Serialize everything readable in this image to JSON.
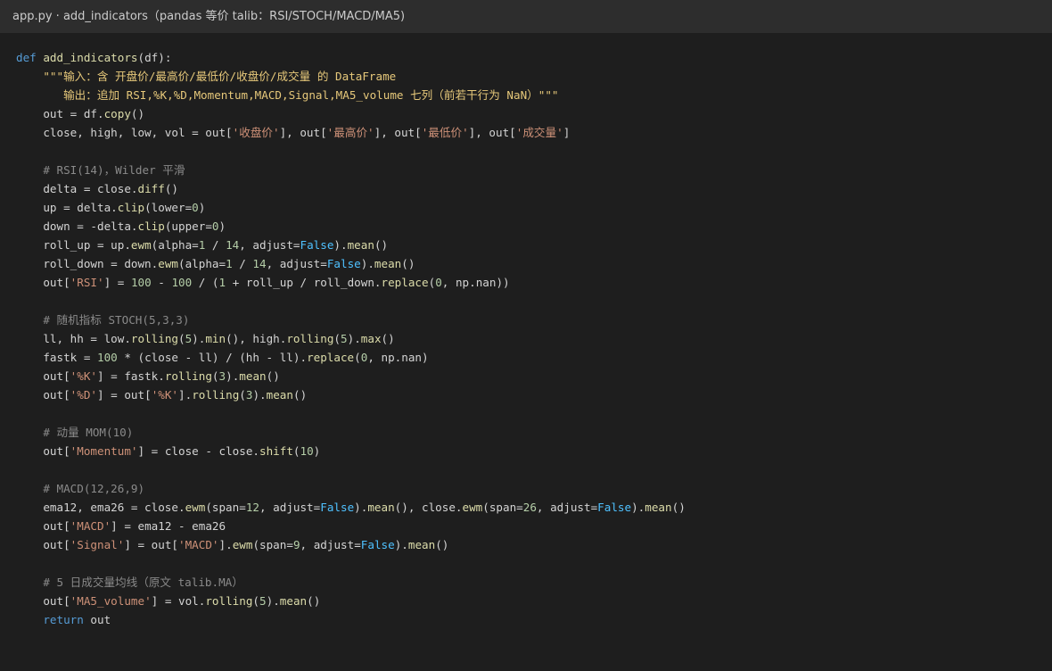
{
  "window": {
    "title": "app.py · add_indicators（pandas 等价 talib：RSI/STOCH/MACD/MA5)"
  },
  "colors": {
    "background": "#1e1e1e",
    "titlebar": "#2d2d2d",
    "keyword": "#569cd6",
    "function": "#dcdcaa",
    "string": "#ce9178",
    "number": "#b5cea8",
    "comment": "#8a8a8a",
    "boolean": "#4fc1ff"
  },
  "code": {
    "lines": [
      [
        {
          "t": "def ",
          "c": "kw"
        },
        {
          "t": "add_indicators",
          "c": "fn"
        },
        {
          "t": "(df):"
        }
      ],
      [
        {
          "t": "    \"\"\"输入：含 开盘价/最高价/最低价/收盘价/成交量 的 DataFrame",
          "c": "doc"
        }
      ],
      [
        {
          "t": "       输出：追加 RSI,%K,%D,Momentum,MACD,Signal,MA5_volume 七列（前若干行为 NaN）\"\"\"",
          "c": "doc"
        }
      ],
      [
        {
          "t": "    out = df."
        },
        {
          "t": "copy",
          "c": "fn"
        },
        {
          "t": "()"
        }
      ],
      [
        {
          "t": "    close, high, low, vol = out["
        },
        {
          "t": "'收盘价'",
          "c": "str"
        },
        {
          "t": "], out["
        },
        {
          "t": "'最高价'",
          "c": "str"
        },
        {
          "t": "], out["
        },
        {
          "t": "'最低价'",
          "c": "str"
        },
        {
          "t": "], out["
        },
        {
          "t": "'成交量'",
          "c": "str"
        },
        {
          "t": "]"
        }
      ],
      [],
      [
        {
          "t": "    # RSI(14)，Wilder 平滑",
          "c": "cmt"
        }
      ],
      [
        {
          "t": "    delta = close."
        },
        {
          "t": "diff",
          "c": "fn"
        },
        {
          "t": "()"
        }
      ],
      [
        {
          "t": "    up = delta."
        },
        {
          "t": "clip",
          "c": "fn"
        },
        {
          "t": "(lower="
        },
        {
          "t": "0",
          "c": "num"
        },
        {
          "t": ")"
        }
      ],
      [
        {
          "t": "    down = -delta."
        },
        {
          "t": "clip",
          "c": "fn"
        },
        {
          "t": "(upper="
        },
        {
          "t": "0",
          "c": "num"
        },
        {
          "t": ")"
        }
      ],
      [
        {
          "t": "    roll_up = up."
        },
        {
          "t": "ewm",
          "c": "fn"
        },
        {
          "t": "(alpha="
        },
        {
          "t": "1",
          "c": "num"
        },
        {
          "t": " / "
        },
        {
          "t": "14",
          "c": "num"
        },
        {
          "t": ", adjust="
        },
        {
          "t": "False",
          "c": "bool"
        },
        {
          "t": ")."
        },
        {
          "t": "mean",
          "c": "fn"
        },
        {
          "t": "()"
        }
      ],
      [
        {
          "t": "    roll_down = down."
        },
        {
          "t": "ewm",
          "c": "fn"
        },
        {
          "t": "(alpha="
        },
        {
          "t": "1",
          "c": "num"
        },
        {
          "t": " / "
        },
        {
          "t": "14",
          "c": "num"
        },
        {
          "t": ", adjust="
        },
        {
          "t": "False",
          "c": "bool"
        },
        {
          "t": ")."
        },
        {
          "t": "mean",
          "c": "fn"
        },
        {
          "t": "()"
        }
      ],
      [
        {
          "t": "    out["
        },
        {
          "t": "'RSI'",
          "c": "str"
        },
        {
          "t": "] = "
        },
        {
          "t": "100",
          "c": "num"
        },
        {
          "t": " - "
        },
        {
          "t": "100",
          "c": "num"
        },
        {
          "t": " / ("
        },
        {
          "t": "1",
          "c": "num"
        },
        {
          "t": " + roll_up / roll_down."
        },
        {
          "t": "replace",
          "c": "fn"
        },
        {
          "t": "("
        },
        {
          "t": "0",
          "c": "num"
        },
        {
          "t": ", np.nan))"
        }
      ],
      [],
      [
        {
          "t": "    # 随机指标 STOCH(5,3,3)",
          "c": "cmt"
        }
      ],
      [
        {
          "t": "    ll, hh = low."
        },
        {
          "t": "rolling",
          "c": "fn"
        },
        {
          "t": "("
        },
        {
          "t": "5",
          "c": "num"
        },
        {
          "t": ")."
        },
        {
          "t": "min",
          "c": "fn"
        },
        {
          "t": "(), high."
        },
        {
          "t": "rolling",
          "c": "fn"
        },
        {
          "t": "("
        },
        {
          "t": "5",
          "c": "num"
        },
        {
          "t": ")."
        },
        {
          "t": "max",
          "c": "fn"
        },
        {
          "t": "()"
        }
      ],
      [
        {
          "t": "    fastk = "
        },
        {
          "t": "100",
          "c": "num"
        },
        {
          "t": " * (close - ll) / (hh - ll)."
        },
        {
          "t": "replace",
          "c": "fn"
        },
        {
          "t": "("
        },
        {
          "t": "0",
          "c": "num"
        },
        {
          "t": ", np.nan)"
        }
      ],
      [
        {
          "t": "    out["
        },
        {
          "t": "'%K'",
          "c": "str"
        },
        {
          "t": "] = fastk."
        },
        {
          "t": "rolling",
          "c": "fn"
        },
        {
          "t": "("
        },
        {
          "t": "3",
          "c": "num"
        },
        {
          "t": ")."
        },
        {
          "t": "mean",
          "c": "fn"
        },
        {
          "t": "()"
        }
      ],
      [
        {
          "t": "    out["
        },
        {
          "t": "'%D'",
          "c": "str"
        },
        {
          "t": "] = out["
        },
        {
          "t": "'%K'",
          "c": "str"
        },
        {
          "t": "]."
        },
        {
          "t": "rolling",
          "c": "fn"
        },
        {
          "t": "("
        },
        {
          "t": "3",
          "c": "num"
        },
        {
          "t": ")."
        },
        {
          "t": "mean",
          "c": "fn"
        },
        {
          "t": "()"
        }
      ],
      [],
      [
        {
          "t": "    # 动量 MOM(10)",
          "c": "cmt"
        }
      ],
      [
        {
          "t": "    out["
        },
        {
          "t": "'Momentum'",
          "c": "str"
        },
        {
          "t": "] = close - close."
        },
        {
          "t": "shift",
          "c": "fn"
        },
        {
          "t": "("
        },
        {
          "t": "10",
          "c": "num"
        },
        {
          "t": ")"
        }
      ],
      [],
      [
        {
          "t": "    # MACD(12,26,9)",
          "c": "cmt"
        }
      ],
      [
        {
          "t": "    ema12, ema26 = close."
        },
        {
          "t": "ewm",
          "c": "fn"
        },
        {
          "t": "(span="
        },
        {
          "t": "12",
          "c": "num"
        },
        {
          "t": ", adjust="
        },
        {
          "t": "False",
          "c": "bool"
        },
        {
          "t": ")."
        },
        {
          "t": "mean",
          "c": "fn"
        },
        {
          "t": "(), close."
        },
        {
          "t": "ewm",
          "c": "fn"
        },
        {
          "t": "(span="
        },
        {
          "t": "26",
          "c": "num"
        },
        {
          "t": ", adjust="
        },
        {
          "t": "False",
          "c": "bool"
        },
        {
          "t": ")."
        },
        {
          "t": "mean",
          "c": "fn"
        },
        {
          "t": "()"
        }
      ],
      [
        {
          "t": "    out["
        },
        {
          "t": "'MACD'",
          "c": "str"
        },
        {
          "t": "] = ema12 - ema26"
        }
      ],
      [
        {
          "t": "    out["
        },
        {
          "t": "'Signal'",
          "c": "str"
        },
        {
          "t": "] = out["
        },
        {
          "t": "'MACD'",
          "c": "str"
        },
        {
          "t": "]."
        },
        {
          "t": "ewm",
          "c": "fn"
        },
        {
          "t": "(span="
        },
        {
          "t": "9",
          "c": "num"
        },
        {
          "t": ", adjust="
        },
        {
          "t": "False",
          "c": "bool"
        },
        {
          "t": ")."
        },
        {
          "t": "mean",
          "c": "fn"
        },
        {
          "t": "()"
        }
      ],
      [],
      [
        {
          "t": "    # 5 日成交量均线（原文 talib.MA）",
          "c": "cmt"
        }
      ],
      [
        {
          "t": "    out["
        },
        {
          "t": "'MA5_volume'",
          "c": "str"
        },
        {
          "t": "] = vol."
        },
        {
          "t": "rolling",
          "c": "fn"
        },
        {
          "t": "("
        },
        {
          "t": "5",
          "c": "num"
        },
        {
          "t": ")."
        },
        {
          "t": "mean",
          "c": "fn"
        },
        {
          "t": "()"
        }
      ],
      [
        {
          "t": "    "
        },
        {
          "t": "return",
          "c": "kw"
        },
        {
          "t": " out"
        }
      ]
    ]
  }
}
